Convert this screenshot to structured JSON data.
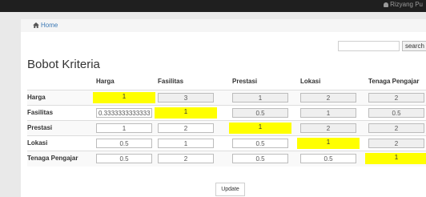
{
  "topbar": {
    "user_label": "Rizyang Pu"
  },
  "breadcrumb": {
    "home": "Home"
  },
  "search": {
    "placeholder": "",
    "value": "",
    "button": "search"
  },
  "page_title": "Bobot Kriteria",
  "table": {
    "columns": [
      "Harga",
      "Fasilitas",
      "Prestasi",
      "Lokasi",
      "Tenaga Pengajar"
    ],
    "rows": [
      {
        "label": "Harga",
        "cells": [
          "1",
          "3",
          "1",
          "2",
          "2"
        ]
      },
      {
        "label": "Fasilitas",
        "cells": [
          "0.33333333333333",
          "1",
          "0.5",
          "1",
          "0.5"
        ]
      },
      {
        "label": "Prestasi",
        "cells": [
          "1",
          "2",
          "1",
          "2",
          "2"
        ]
      },
      {
        "label": "Lokasi",
        "cells": [
          "0.5",
          "1",
          "0.5",
          "1",
          "2"
        ]
      },
      {
        "label": "Tenaga Pengajar",
        "cells": [
          "0.5",
          "2",
          "0.5",
          "0.5",
          "1"
        ]
      }
    ]
  },
  "update_button": "Update",
  "colors": {
    "diagonal": "#ffff00",
    "link": "#3a78b5",
    "topbar": "#1f1f1f"
  }
}
